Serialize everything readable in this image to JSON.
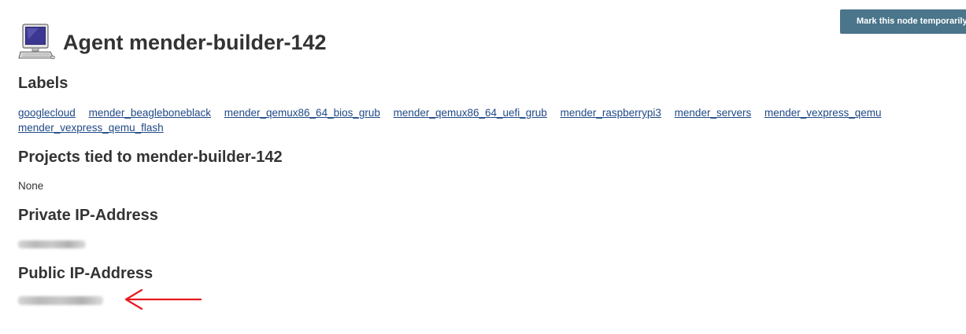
{
  "toolbar": {
    "mark_offline_label": "Mark this node temporarily offline"
  },
  "header": {
    "icon": "computer-icon",
    "title": "Agent mender-builder-142"
  },
  "labels_section": {
    "heading": "Labels",
    "links": [
      "googlecloud",
      "mender_beagleboneblack",
      "mender_qemux86_64_bios_grub",
      "mender_qemux86_64_uefi_grub",
      "mender_raspberrypi3",
      "mender_servers",
      "mender_vexpress_qemu",
      "mender_vexpress_qemu_flash"
    ]
  },
  "projects_section": {
    "heading": "Projects tied to mender-builder-142",
    "value": "None"
  },
  "private_ip_section": {
    "heading": "Private IP-Address"
  },
  "public_ip_section": {
    "heading": "Public IP-Address"
  },
  "colors": {
    "button_bg": "#4b758b",
    "link": "#204a87",
    "text": "#333333",
    "annotation_arrow": "#e8191f"
  }
}
